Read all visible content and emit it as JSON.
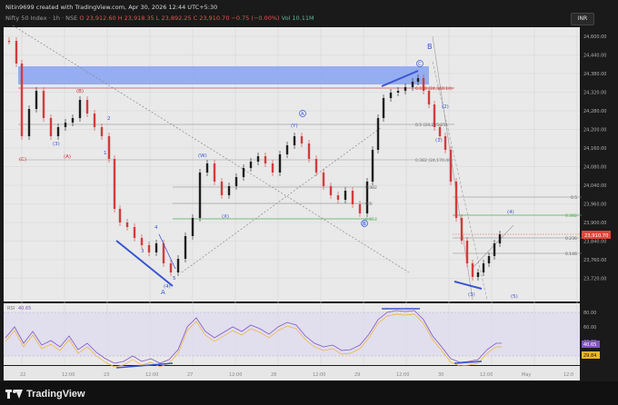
{
  "header": {
    "attribution": "Nitin9699 created with TradingView.com, Apr 30, 2026 12:44 UTC+5:30",
    "symbol": "Nifty 50 Index · 1h · NSE",
    "ohlc": "O 23,912.60  H 23,918.35  L 23,892.25  C 23,910.70  −0.75 (−0.00%)",
    "volume": "Vol 10.11M"
  },
  "currency_button": "INR",
  "footer": {
    "brand": "TradingView"
  },
  "price_axis": {
    "ticks": [
      "24,600.00",
      "24,440.00",
      "24,380.00",
      "24,320.00",
      "24,280.00",
      "24,200.00",
      "24,160.00",
      "24,080.00",
      "24,040.00",
      "23,960.00",
      "23,900.00",
      "23,840.00",
      "23,760.00",
      "23,720.00"
    ],
    "current_price": "23,910.70",
    "current_color": "#e0453a"
  },
  "rsi_axis": {
    "ticks": [
      "80.00",
      "60.00",
      "40.00",
      "20.00"
    ],
    "current_value": "40.65",
    "current_color": "#7e57c2",
    "lower_value": "29.84",
    "lower_color": "#f0b429"
  },
  "rsi_label": {
    "name": "RSI",
    "value": "40.65"
  },
  "time_axis": {
    "ticks": [
      "22",
      "12:00",
      "23",
      "12:00",
      "27",
      "12:00",
      "28",
      "12:00",
      "29",
      "12:00",
      "30",
      "12:00",
      "May",
      "12:0"
    ]
  },
  "wave_labels": {
    "red_b_top": "(B)",
    "red_c": "(C)",
    "red_a": "(A)",
    "blue_3": "(3)",
    "blue_1": "1",
    "blue_2": "2",
    "blue_4": "4",
    "blue_3b": "3",
    "blue_5": "5",
    "blue_4p": "(4)",
    "blue_5p": "(5)",
    "blue_A": "A",
    "blue_W": "(W)",
    "blue_X": "(X)",
    "blue_Y": "(Y)",
    "circle_A": "A",
    "circle_B_big": "B",
    "circle_C": "C",
    "circle_B": "B",
    "blue_2p": "(2)",
    "blue_1p": "(1)",
    "blue_3r": "(3)",
    "blue_4r": "(4)",
    "blue_5r": "(5)"
  },
  "fib_labels": {
    "f0618": "0.618 (24,360.10)",
    "f05": "0.5 (24,265.25)",
    "f0382": "0.382 (24,170.40)",
    "m0382": "0.382",
    "m05": "0.5",
    "m0618": "0.618",
    "r05": "0.5",
    "r0382": "0.382",
    "r0236": "0.236",
    "r0146": "0.146"
  },
  "colors": {
    "background": "#e9e9e9",
    "up_candle": "#1f1f1f",
    "down_candle": "#d23c3c",
    "wave_blue": "#3a55d0",
    "wave_red": "#c83232",
    "zone_fill": "#7f9ef2",
    "rsi_line": "#7e57c2",
    "rsi_ma": "#f0b429"
  }
}
